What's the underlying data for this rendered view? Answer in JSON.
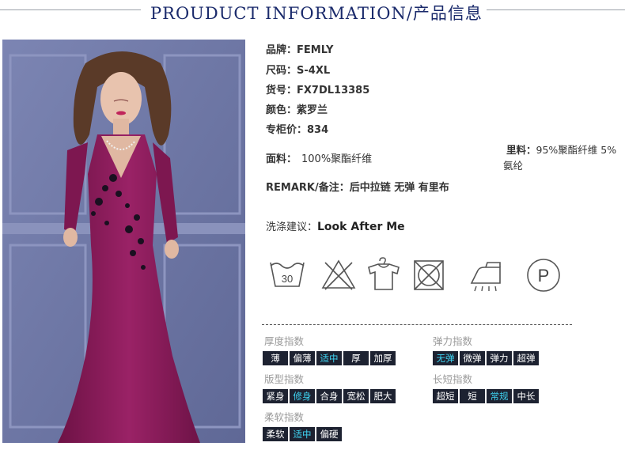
{
  "header": {
    "title": "PROUDUCT INFORMATION/产品信息"
  },
  "specs": [
    {
      "label": "品牌：",
      "value": "FEMLY"
    },
    {
      "label": "尺码：",
      "value": "S-4XL"
    },
    {
      "label": "货号：",
      "value": "FX7DL13385"
    },
    {
      "label": "颜色：",
      "value": "紫罗兰"
    },
    {
      "label": "专柜价：",
      "value": "834"
    }
  ],
  "fabric": {
    "label": "面料：",
    "value": "100%聚酯纤维"
  },
  "lining": {
    "label": "里料：",
    "value": "95%聚酯纤维 5%氨纶"
  },
  "remark": {
    "label": "REMARK/备注：",
    "value": "后中拉链 无弹 有里布"
  },
  "wash": {
    "label": "洗涤建议：",
    "value": "Look After Me"
  },
  "care_icons": [
    "wash-30-icon",
    "no-bleach-icon",
    "hang-dry-icon",
    "no-tumble-dry-icon",
    "iron-low-icon",
    "dry-clean-p-icon"
  ],
  "care_wash_temp": "30",
  "care_dryclean_letter": "P",
  "indices": [
    {
      "title": "厚度指数",
      "options": [
        "薄",
        "偏薄",
        "适中",
        "厚",
        "加厚"
      ],
      "selected": "适中"
    },
    {
      "title": "弹力指数",
      "options": [
        "无弹",
        "微弹",
        "弹力",
        "超弹"
      ],
      "selected": "无弹"
    },
    {
      "title": "版型指数",
      "options": [
        "紧身",
        "修身",
        "合身",
        "宽松",
        "肥大"
      ],
      "selected": "修身"
    },
    {
      "title": "长短指数",
      "options": [
        "超短",
        "短",
        "常规",
        "中长"
      ],
      "selected": "常规"
    },
    {
      "title": "柔软指数",
      "options": [
        "柔软",
        "适中",
        "偏硬"
      ],
      "selected": "适中"
    }
  ],
  "colors": {
    "header": "#1a2a6b",
    "chip_bg": "#1d2231",
    "chip_selected": "#3fd4f2",
    "dress": "#8e1b5b",
    "backdrop": "#6f78a6"
  }
}
